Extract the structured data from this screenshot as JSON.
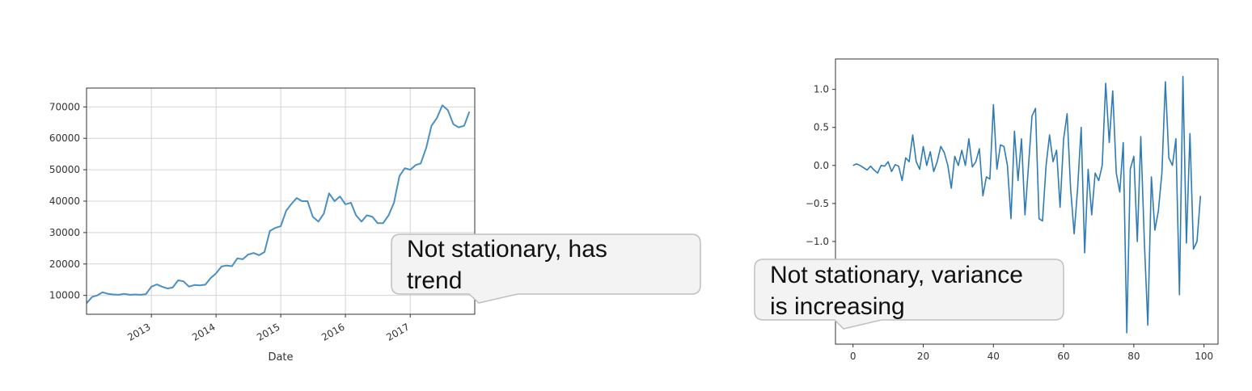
{
  "chart_data": [
    {
      "type": "line",
      "title": "",
      "xlabel": "Date",
      "ylabel": "",
      "grid": true,
      "line_color": "#4a90c2",
      "xlim": [
        "2012-01-01",
        "2017-12-31"
      ],
      "ylim": [
        4000,
        76000
      ],
      "x_ticks": [
        "2013-01-01",
        "2014-01-01",
        "2015-01-01",
        "2016-01-01",
        "2017-01-01"
      ],
      "x_tick_labels": [
        "2013",
        "2014",
        "2015",
        "2016",
        "2017"
      ],
      "y_ticks": [
        10000,
        20000,
        30000,
        40000,
        50000,
        60000,
        70000
      ],
      "y_tick_labels": [
        "10000",
        "20000",
        "30000",
        "40000",
        "50000",
        "60000",
        "70000"
      ],
      "series": [
        {
          "x": [
            "2012-01-01",
            "2012-02-01",
            "2012-03-01",
            "2012-04-01",
            "2012-05-01",
            "2012-06-01",
            "2012-07-01",
            "2012-08-01",
            "2012-09-01",
            "2012-10-01",
            "2012-11-01",
            "2012-12-01",
            "2013-01-01",
            "2013-02-01",
            "2013-03-01",
            "2013-04-01",
            "2013-05-01",
            "2013-06-01",
            "2013-07-01",
            "2013-08-01",
            "2013-09-01",
            "2013-10-01",
            "2013-11-01",
            "2013-12-01",
            "2014-01-01",
            "2014-02-01",
            "2014-03-01",
            "2014-04-01",
            "2014-05-01",
            "2014-06-01",
            "2014-07-01",
            "2014-08-01",
            "2014-09-01",
            "2014-10-01",
            "2014-11-01",
            "2014-12-01",
            "2015-01-01",
            "2015-02-01",
            "2015-03-01",
            "2015-04-01",
            "2015-05-01",
            "2015-06-01",
            "2015-07-01",
            "2015-08-01",
            "2015-09-01",
            "2015-10-01",
            "2015-11-01",
            "2015-12-01",
            "2016-01-01",
            "2016-02-01",
            "2016-03-01",
            "2016-04-01",
            "2016-05-01",
            "2016-06-01",
            "2016-07-01",
            "2016-08-01",
            "2016-09-01",
            "2016-10-01",
            "2016-11-01",
            "2016-12-01",
            "2017-01-01",
            "2017-02-01",
            "2017-03-01",
            "2017-04-01",
            "2017-05-01",
            "2017-06-01",
            "2017-07-01",
            "2017-08-01",
            "2017-09-01",
            "2017-10-01",
            "2017-11-01",
            "2017-12-01"
          ],
          "values": [
            7500,
            9500,
            10000,
            11000,
            10500,
            10300,
            10200,
            10500,
            10200,
            10300,
            10200,
            10400,
            12800,
            13500,
            12800,
            12200,
            12500,
            14800,
            14500,
            12800,
            13300,
            13200,
            13400,
            15500,
            17000,
            19200,
            19500,
            19300,
            21800,
            21500,
            23000,
            23500,
            22800,
            23800,
            30500,
            31500,
            32000,
            37000,
            39000,
            41000,
            40000,
            40000,
            35000,
            33500,
            36000,
            42500,
            40000,
            41500,
            39000,
            39500,
            35500,
            33500,
            35500,
            35000,
            33000,
            33000,
            35500,
            39500,
            48000,
            50500,
            50000,
            51500,
            52000,
            57000,
            64000,
            66500,
            70500,
            69000,
            64500,
            63500,
            64000,
            68500
          ]
        }
      ]
    },
    {
      "type": "line",
      "title": "",
      "xlabel": "",
      "ylabel": "",
      "grid": false,
      "line_color": "#2f7bb5",
      "xlim": [
        -5,
        104
      ],
      "ylim": [
        -2.35,
        1.4
      ],
      "x_ticks": [
        0,
        20,
        40,
        60,
        80,
        100
      ],
      "x_tick_labels": [
        "0",
        "20",
        "40",
        "60",
        "80",
        "100"
      ],
      "y_ticks": [
        1.0,
        0.5,
        0.0,
        -0.5,
        -1.0
      ],
      "y_tick_labels": [
        "1.0",
        "0.5",
        "0.0",
        "−0.5",
        "−1.0"
      ],
      "series": [
        {
          "x": [
            0,
            1,
            2,
            3,
            4,
            5,
            6,
            7,
            8,
            9,
            10,
            11,
            12,
            13,
            14,
            15,
            16,
            17,
            18,
            19,
            20,
            21,
            22,
            23,
            24,
            25,
            26,
            27,
            28,
            29,
            30,
            31,
            32,
            33,
            34,
            35,
            36,
            37,
            38,
            39,
            40,
            41,
            42,
            43,
            44,
            45,
            46,
            47,
            48,
            49,
            50,
            51,
            52,
            53,
            54,
            55,
            56,
            57,
            58,
            59,
            60,
            61,
            62,
            63,
            64,
            65,
            66,
            67,
            68,
            69,
            70,
            71,
            72,
            73,
            74,
            75,
            76,
            77,
            78,
            79,
            80,
            81,
            82,
            83,
            84,
            85,
            86,
            87,
            88,
            89,
            90,
            91,
            92,
            93,
            94,
            95,
            96,
            97,
            98,
            99
          ],
          "values": [
            0.0,
            0.02,
            0.0,
            -0.03,
            -0.06,
            -0.01,
            -0.06,
            -0.1,
            0.0,
            -0.01,
            0.05,
            -0.08,
            0.01,
            -0.01,
            -0.2,
            0.1,
            0.05,
            0.4,
            0.05,
            -0.05,
            0.25,
            0.0,
            0.18,
            -0.08,
            0.05,
            0.25,
            0.17,
            0.0,
            -0.3,
            0.12,
            0.0,
            0.2,
            0.0,
            0.35,
            -0.02,
            0.05,
            0.22,
            -0.4,
            -0.15,
            -0.18,
            0.8,
            -0.05,
            0.27,
            0.25,
            0.0,
            -0.7,
            0.45,
            -0.2,
            0.35,
            -0.65,
            0.0,
            0.65,
            0.75,
            -0.7,
            -0.73,
            0.0,
            0.4,
            0.05,
            0.2,
            -0.55,
            0.35,
            0.68,
            -0.3,
            -0.9,
            -0.3,
            0.5,
            -1.15,
            -0.05,
            -0.65,
            -0.1,
            -0.2,
            0.0,
            1.08,
            0.3,
            0.98,
            -0.1,
            -0.35,
            0.3,
            -2.2,
            -0.05,
            0.12,
            -1.0,
            0.38,
            -1.0,
            -2.1,
            -0.15,
            -0.85,
            -0.6,
            -0.1,
            1.1,
            0.1,
            0.0,
            0.35,
            -1.7,
            1.17,
            -1.02,
            0.42,
            -1.1,
            -1.0,
            -0.4
          ]
        }
      ]
    }
  ],
  "callouts": [
    {
      "line1": "Not stationary, has",
      "line2": "trend"
    },
    {
      "line1": "Not stationary, variance",
      "line2": "is increasing"
    }
  ]
}
